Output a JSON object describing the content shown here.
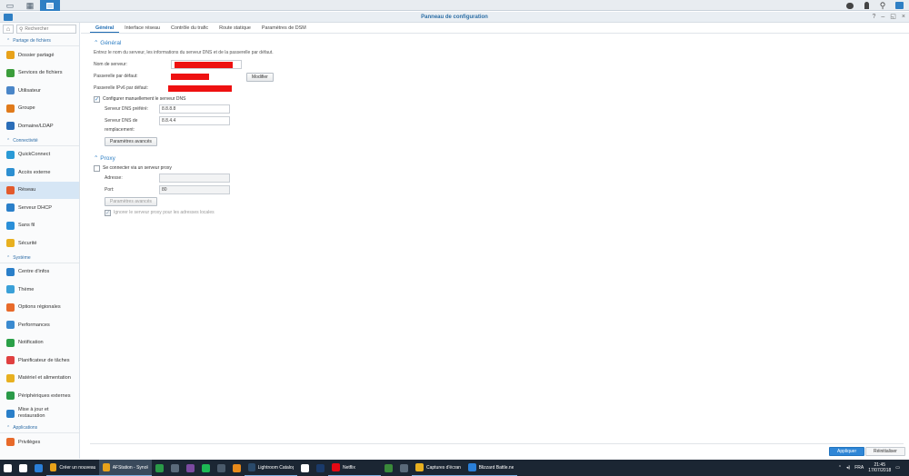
{
  "desktop": {
    "topbar_icons": [
      "grid-icon",
      "apps-icon",
      "window-icon"
    ],
    "right_icons": [
      "chat-icon",
      "person-icon",
      "search-icon",
      "widget-icon"
    ]
  },
  "window": {
    "title": "Panneau de configuration",
    "controls": [
      "?",
      "–",
      "◱",
      "×"
    ]
  },
  "sidebar": {
    "search_placeholder": "Rechercher",
    "sections": [
      {
        "title": "Partage de fichiers",
        "items": [
          {
            "label": "Dossier partagé",
            "icon": "folder-icon",
            "color": "#e8a21a"
          },
          {
            "label": "Services de fichiers",
            "icon": "file-services-icon",
            "color": "#3b9d3b"
          },
          {
            "label": "Utilisateur",
            "icon": "user-icon",
            "color": "#4a86c8"
          },
          {
            "label": "Groupe",
            "icon": "group-icon",
            "color": "#e07a1b"
          },
          {
            "label": "Domaine/LDAP",
            "icon": "domain-icon",
            "color": "#2a6db8"
          }
        ]
      },
      {
        "title": "Connectivité",
        "items": [
          {
            "label": "QuickConnect",
            "icon": "quickconnect-icon",
            "color": "#2a9ad6"
          },
          {
            "label": "Accès externe",
            "icon": "globe-icon",
            "color": "#2d8fd1"
          },
          {
            "label": "Réseau",
            "icon": "home-network-icon",
            "color": "#e35a2c",
            "active": true
          },
          {
            "label": "Serveur DHCP",
            "icon": "dhcp-icon",
            "color": "#2a7fc9"
          },
          {
            "label": "Sans fil",
            "icon": "wifi-icon",
            "color": "#2a8fd8"
          },
          {
            "label": "Sécurité",
            "icon": "shield-icon",
            "color": "#e8b020"
          }
        ]
      },
      {
        "title": "Système",
        "items": [
          {
            "label": "Centre d'infos",
            "icon": "info-icon",
            "color": "#2a7fc9"
          },
          {
            "label": "Thème",
            "icon": "theme-icon",
            "color": "#3aa0d8"
          },
          {
            "label": "Options régionales",
            "icon": "regional-icon",
            "color": "#e86a2a"
          },
          {
            "label": "Performances",
            "icon": "performance-icon",
            "color": "#3a8ad0"
          },
          {
            "label": "Notification",
            "icon": "notification-icon",
            "color": "#2aa048"
          },
          {
            "label": "Planificateur de tâches",
            "icon": "calendar-icon",
            "color": "#e04040"
          },
          {
            "label": "Matériel et alimentation",
            "icon": "bulb-icon",
            "color": "#e8b020"
          },
          {
            "label": "Périphériques externes",
            "icon": "usb-icon",
            "color": "#2a9a48"
          },
          {
            "label": "Mise à jour et",
            "label2": "restauration",
            "icon": "update-icon",
            "color": "#2a7fc9"
          }
        ]
      },
      {
        "title": "Applications",
        "items": [
          {
            "label": "Privilèges",
            "icon": "privileges-icon",
            "color": "#e86a2a"
          }
        ]
      }
    ]
  },
  "tabs": [
    "Général",
    "Interface réseau",
    "Contrôle du trafic",
    "Route statique",
    "Paramètres de DSM"
  ],
  "general": {
    "title": "Général",
    "description": "Entrez le nom du serveur, les informations du serveur DNS et de la passerelle par défaut.",
    "server_name_label": "Nom de serveur:",
    "gateway_label": "Passerelle par défaut:",
    "ipv6_gateway_label": "Passerelle IPv6 par défaut:",
    "modify_button": "Modifier",
    "manual_dns_label": "Configurer manuellement le serveur DNS",
    "preferred_dns_label": "Serveur DNS préféré:",
    "preferred_dns_value": "8.8.8.8",
    "alternate_dns_label": "Serveur DNS de",
    "alternate_dns_label2": "remplacement:",
    "alternate_dns_value": "8.8.4.4",
    "advanced_button": "Paramètres avancés"
  },
  "proxy": {
    "title": "Proxy",
    "use_proxy_label": "Se connecter via un serveur proxy",
    "address_label": "Adresse:",
    "port_label": "Port:",
    "port_value": "80",
    "advanced_button": "Paramètres avancés",
    "bypass_label": "Ignorer le serveur proxy pour les adresses locales"
  },
  "footer": {
    "apply": "Appliquer",
    "reset": "Réinitialiser"
  },
  "taskbar": {
    "items": [
      {
        "label": "",
        "icon": "windows-icon",
        "color": "#ffffff"
      },
      {
        "label": "",
        "icon": "cortana-icon",
        "color": "#ffffff"
      },
      {
        "label": "",
        "icon": "edge-icon",
        "color": "#2a7fd8"
      },
      {
        "label": "Créer un nouveau s...",
        "icon": "chrome-icon",
        "color": "#e8a21a"
      },
      {
        "label": "AFStation - Synolo...",
        "icon": "chrome-icon",
        "color": "#e8a21a",
        "active": true
      },
      {
        "label": "",
        "icon": "xbox-icon",
        "color": "#2a9a48"
      },
      {
        "label": "",
        "icon": "teamspeak-icon",
        "color": "#5a6a7a"
      },
      {
        "label": "",
        "icon": "tor-icon",
        "color": "#7a4aa0"
      },
      {
        "label": "",
        "icon": "spotify-icon",
        "color": "#1db954"
      },
      {
        "label": "",
        "icon": "stream-icon",
        "color": "#4a5a6a"
      },
      {
        "label": "",
        "icon": "illustrator-icon",
        "color": "#e88a1a"
      },
      {
        "label": "Lightroom Catalog ...",
        "icon": "lightroom-icon",
        "color": "#2a4a6a"
      },
      {
        "label": "",
        "icon": "info-app-icon",
        "color": "#ffffff"
      },
      {
        "label": "",
        "icon": "photoshop-icon",
        "color": "#1a3a6a"
      },
      {
        "label": "Netflix",
        "icon": "netflix-icon",
        "color": "#e50914"
      },
      {
        "label": "",
        "icon": "app-icon",
        "color": "#3a8a3a"
      },
      {
        "label": "",
        "icon": "steam-icon",
        "color": "#5a6a7a"
      },
      {
        "label": "Captures d'écran",
        "icon": "folder-icon",
        "color": "#e8b020"
      },
      {
        "label": "Blizzard Battle.net",
        "icon": "battlenet-icon",
        "color": "#2a7fd8"
      }
    ],
    "lang": "FRA",
    "time": "21:45",
    "date": "17/07/2018"
  }
}
